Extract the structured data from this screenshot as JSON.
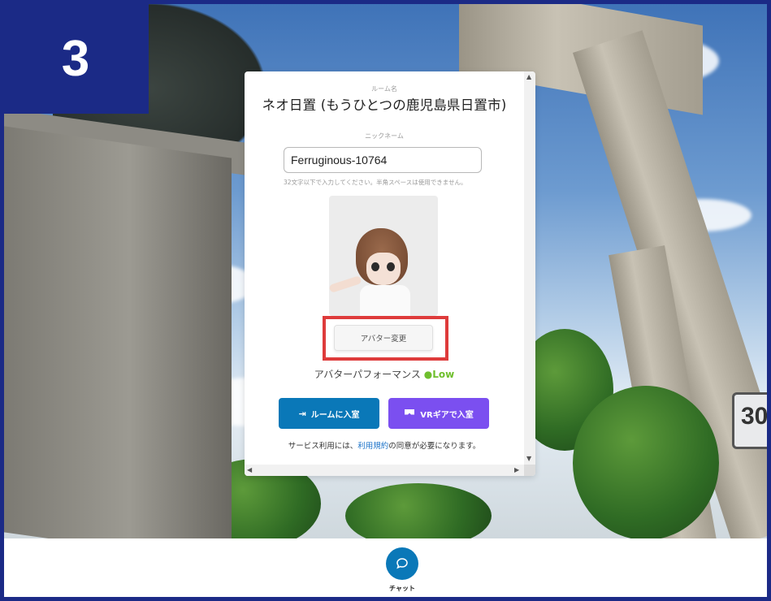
{
  "step_badge": "3",
  "dialog": {
    "room_name_label": "ルーム名",
    "room_name": "ネオ日置 (もうひとつの鹿児島県日置市)",
    "nickname_label": "ニックネーム",
    "nickname_value": "Ferruginous-10764",
    "nickname_hint": "32文字以下で入力してください。半角スペースは使用できません。",
    "avatar_change_label": "アバター変更",
    "avatar_performance_label": "アバターパフォーマンス",
    "avatar_performance_level": "●Low",
    "enter_room_label": "ルームに入室",
    "vr_enter_label": "VRギアで入室",
    "terms_prefix": "サービス利用には、",
    "terms_link": "利用規約",
    "terms_suffix": "の同意が必要になります。"
  },
  "scene": {
    "sign_text": "30"
  },
  "bottom_bar": {
    "chat_label": "チャット"
  },
  "colors": {
    "frame": "#1b2a86",
    "primary_button": "#0a78b8",
    "vr_button": "#7b4ff0",
    "highlight": "#de3b3b",
    "performance_low": "#6fbf2d"
  }
}
